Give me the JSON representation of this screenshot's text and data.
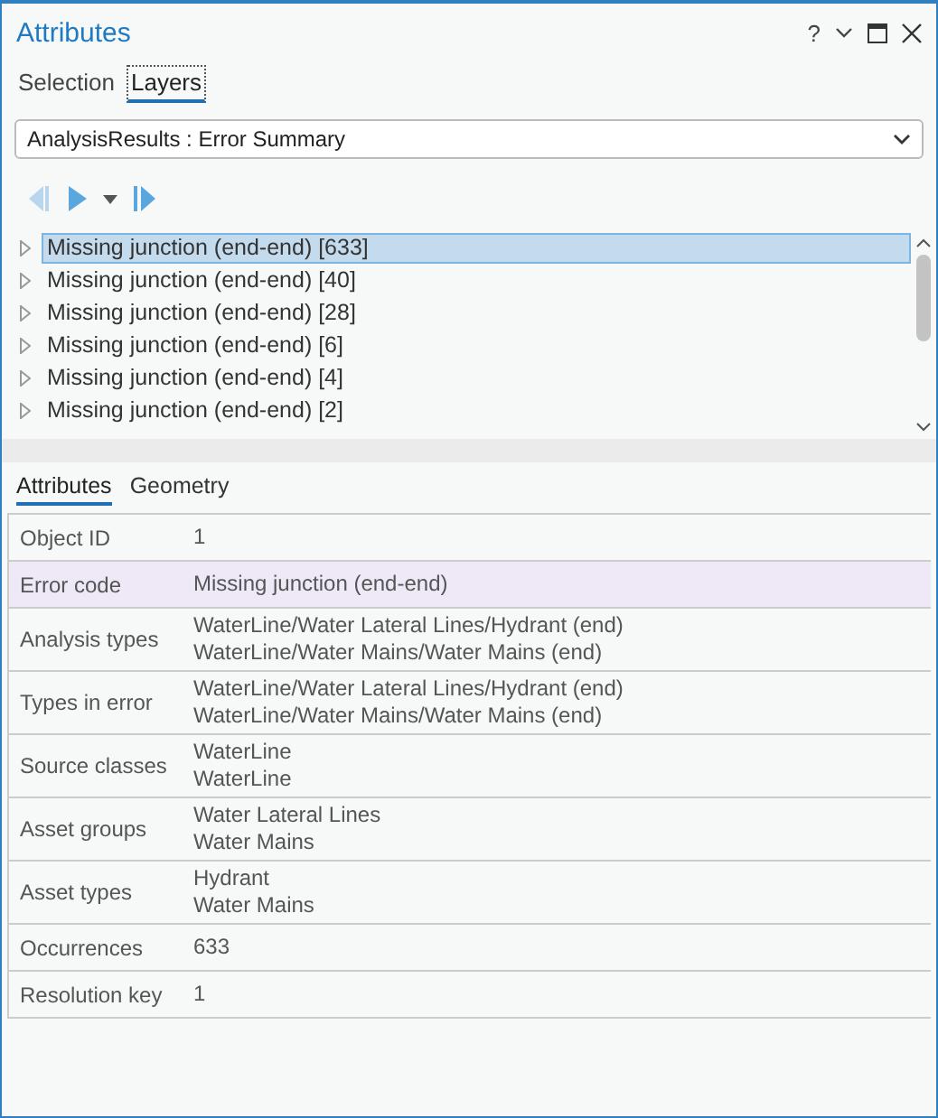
{
  "window": {
    "title": "Attributes",
    "controls": [
      "?"
    ]
  },
  "tabs": [
    {
      "label": "Selection",
      "selected": false
    },
    {
      "label": "Layers",
      "selected": true
    }
  ],
  "layer_dropdown": {
    "value": "AnalysisResults : Error Summary"
  },
  "tree": {
    "items": [
      {
        "label": "Missing junction (end-end) [633]",
        "selected": true,
        "expanded": false
      },
      {
        "label": "Missing junction (end-end) [40]",
        "selected": false,
        "expanded": false
      },
      {
        "label": "Missing junction (end-end) [28]",
        "selected": false,
        "expanded": false
      },
      {
        "label": "Missing junction (end-end) [6]",
        "selected": false,
        "expanded": false
      },
      {
        "label": "Missing junction (end-end) [4]",
        "selected": false,
        "expanded": false
      },
      {
        "label": "Missing junction (end-end) [2]",
        "selected": false,
        "expanded": false
      }
    ]
  },
  "detail_tabs": [
    {
      "label": "Attributes",
      "selected": true
    },
    {
      "label": "Geometry",
      "selected": false
    }
  ],
  "attributes": [
    {
      "field": "Object ID",
      "values": [
        "1"
      ],
      "selected": false
    },
    {
      "field": "Error code",
      "values": [
        "Missing junction (end-end)"
      ],
      "selected": true
    },
    {
      "field": "Analysis types",
      "values": [
        "WaterLine/Water Lateral Lines/Hydrant (end)",
        "WaterLine/Water Mains/Water Mains (end)"
      ],
      "selected": false
    },
    {
      "field": "Types in error",
      "values": [
        "WaterLine/Water Lateral Lines/Hydrant (end)",
        "WaterLine/Water Mains/Water Mains (end)"
      ],
      "selected": false
    },
    {
      "field": "Source classes",
      "values": [
        "WaterLine",
        "WaterLine"
      ],
      "selected": false
    },
    {
      "field": "Asset groups",
      "values": [
        "Water Lateral Lines",
        "Water Mains"
      ],
      "selected": false
    },
    {
      "field": "Asset types",
      "values": [
        "Hydrant",
        "Water Mains"
      ],
      "selected": false
    },
    {
      "field": "Occurrences",
      "values": [
        "633"
      ],
      "selected": false
    },
    {
      "field": "Resolution key",
      "values": [
        "1"
      ],
      "selected": false
    }
  ]
}
